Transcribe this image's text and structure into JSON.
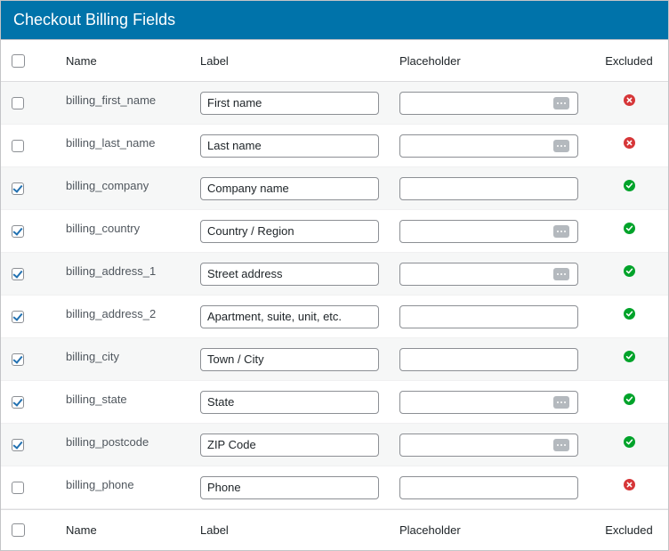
{
  "title": "Checkout Billing Fields",
  "columns": {
    "name": "Name",
    "label": "Label",
    "placeholder": "Placeholder",
    "excluded": "Excluded"
  },
  "icons": {
    "excluded_yes": "check-circle-icon",
    "excluded_no": "x-circle-icon",
    "placeholder_picker": "ellipsis-icon"
  },
  "colors": {
    "header": "#0073aa",
    "excluded_yes": "#00a32a",
    "excluded_no": "#d63638",
    "checkbox_check": "#2271b1"
  },
  "rows": [
    {
      "name": "billing_first_name",
      "label": "First name",
      "checked": false,
      "placeholder": "",
      "has_picker": true,
      "excluded": false
    },
    {
      "name": "billing_last_name",
      "label": "Last name",
      "checked": false,
      "placeholder": "",
      "has_picker": true,
      "excluded": false
    },
    {
      "name": "billing_company",
      "label": "Company name",
      "checked": true,
      "placeholder": "",
      "has_picker": false,
      "excluded": true
    },
    {
      "name": "billing_country",
      "label": "Country / Region",
      "checked": true,
      "placeholder": "",
      "has_picker": true,
      "excluded": true
    },
    {
      "name": "billing_address_1",
      "label": "Street address",
      "checked": true,
      "placeholder": "",
      "has_picker": true,
      "excluded": true
    },
    {
      "name": "billing_address_2",
      "label": "Apartment, suite, unit, etc.",
      "checked": true,
      "placeholder": "",
      "has_picker": false,
      "excluded": true
    },
    {
      "name": "billing_city",
      "label": "Town / City",
      "checked": true,
      "placeholder": "",
      "has_picker": false,
      "excluded": true
    },
    {
      "name": "billing_state",
      "label": "State",
      "checked": true,
      "placeholder": "",
      "has_picker": true,
      "excluded": true
    },
    {
      "name": "billing_postcode",
      "label": "ZIP Code",
      "checked": true,
      "placeholder": "",
      "has_picker": true,
      "excluded": true
    },
    {
      "name": "billing_phone",
      "label": "Phone",
      "checked": false,
      "placeholder": "",
      "has_picker": false,
      "excluded": false
    }
  ]
}
